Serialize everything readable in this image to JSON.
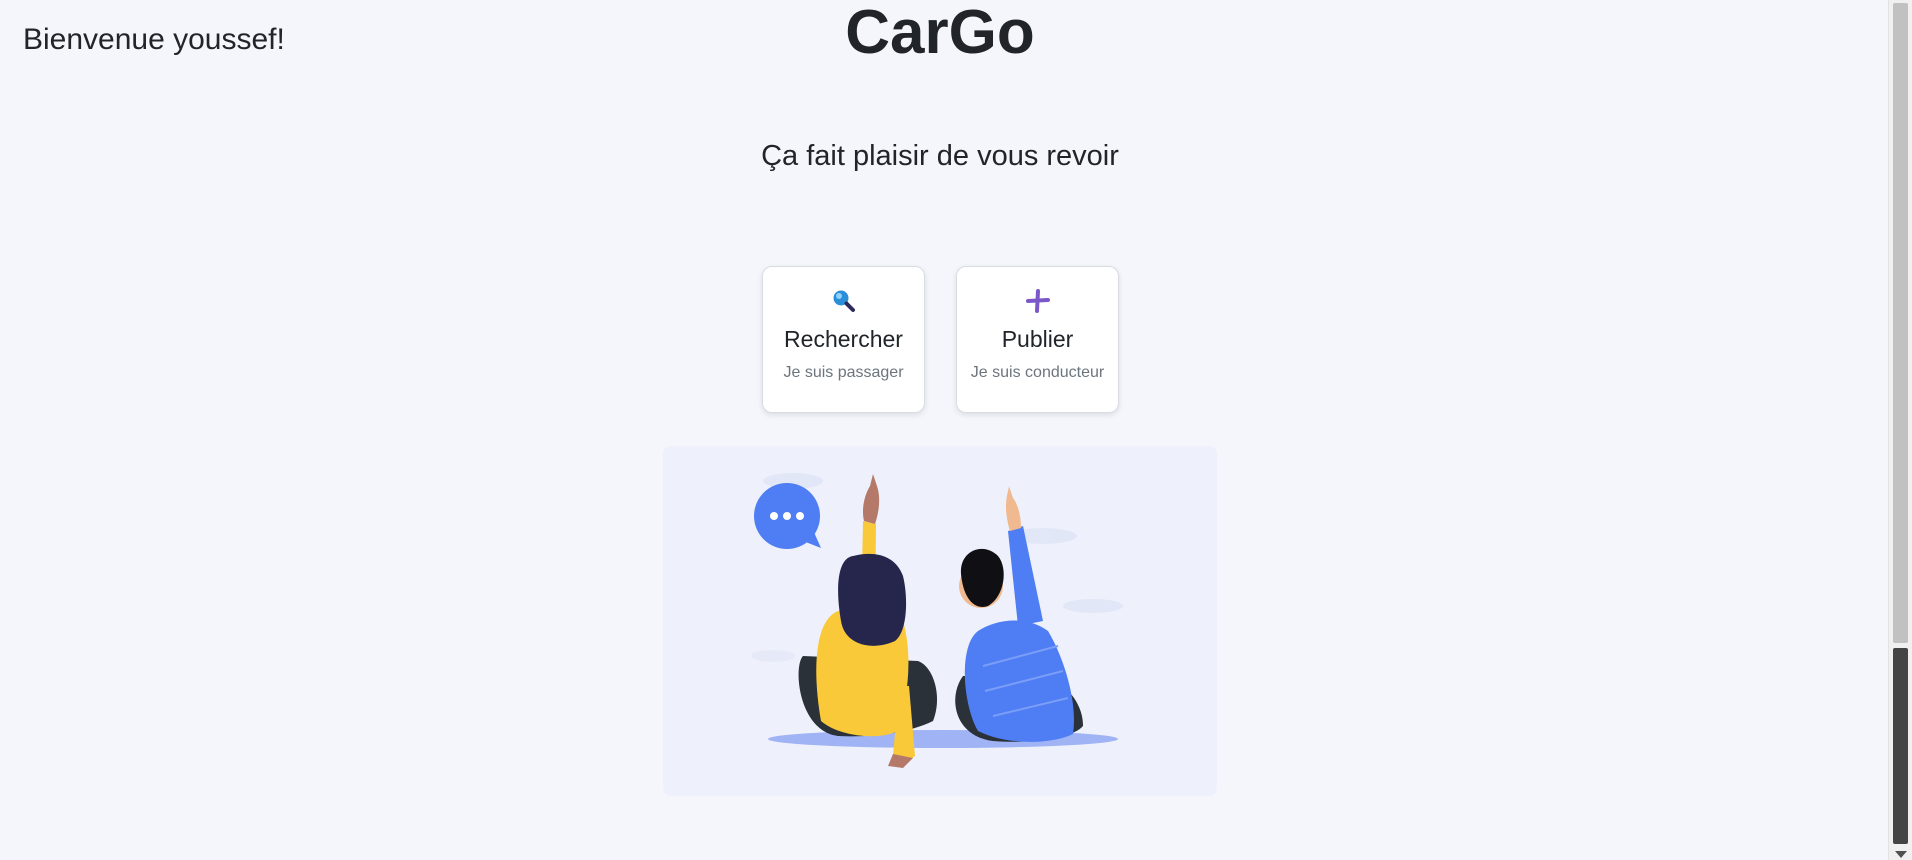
{
  "header": {
    "greeting": "Bienvenue youssef!",
    "brand": "CarGo"
  },
  "main": {
    "subtitle": "Ça fait plaisir de vous revoir",
    "actions": [
      {
        "icon": "magnifier-icon",
        "title": "Rechercher",
        "subtitle": "Je suis passager"
      },
      {
        "icon": "plus-icon",
        "title": "Publier",
        "subtitle": "Je suis conducteur"
      }
    ],
    "illustration": "two-people-pointing-up-illustration"
  },
  "colors": {
    "background": "#f4f6fb",
    "text": "#212529",
    "muted": "#6c757d",
    "accent_purple": "#7b57c9",
    "accent_blue": "#4f7df3",
    "accent_yellow": "#f9c93a"
  }
}
